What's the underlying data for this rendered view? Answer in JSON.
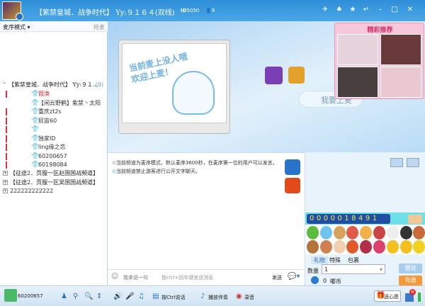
{
  "header": {
    "title": "【紫禁皇城．战争时代】 Yy:９１６４(双线)",
    "id_label": "ID",
    "id_value": "5050",
    "user_count": "9",
    "window_buttons": [
      "plane-icon",
      "skin-icon",
      "star-icon",
      "back-icon",
      "minimize-icon",
      "maximize-icon",
      "close-icon"
    ]
  },
  "left": {
    "mode": "麦序模式",
    "grab": "抢麦",
    "root": "【紫禁皇城．战争时代】 Yy:９１...",
    "root_count": "(9)",
    "users": [
      {
        "name": "葭涣",
        "color": "#e02020",
        "mic": true
      },
      {
        "name": "【闲云野鹤】紫禁丶太阳",
        "color": "#333",
        "mic": false,
        "shirt": "#7a3fb4"
      },
      {
        "name": "重庆zt2s",
        "color": "#333",
        "mic": true
      },
      {
        "name": "屁宙60",
        "color": "#333",
        "mic": true
      },
      {
        "name": "",
        "color": "#333",
        "mic": true
      },
      {
        "name": "独家ID",
        "color": "#333",
        "mic": true
      },
      {
        "name": "ling缘之恋",
        "color": "#333",
        "mic": true
      },
      {
        "name": "60200657",
        "color": "#333",
        "mic": true
      },
      {
        "name": "60198084",
        "color": "#333",
        "mic": true
      }
    ],
    "channels": [
      "【征途2．页服一区赵国国战频道】",
      "【征途2．页服一区吴国国战频道】",
      "222222222222"
    ]
  },
  "stage": {
    "screen_text_1": "当前麦上没人哦",
    "screen_text_2": "欢迎上麦！",
    "mic_button": "我要上麦",
    "recommend_title": "精彩推荐"
  },
  "chat": {
    "messages": [
      "当前频道为麦序模式，默认麦序3600秒，在麦序第一位的用户可以发言。",
      "当前频道禁止游客进行公开文字聊天。"
    ],
    "input_placeholder": "我来说一句",
    "input_hint": "按ctrl+回车键发送消息",
    "send": "发送"
  },
  "gift": {
    "counter": "0000018491",
    "tabs": [
      "礼物",
      "特殊",
      "包裹"
    ],
    "quantity_label": "数量",
    "quantity": "1",
    "give": "赠送",
    "coins": "0",
    "coin_unit": "嘟币",
    "recharge": "充值"
  },
  "bottom": {
    "user": "60200657",
    "ptt": "按Ctrl说话",
    "accompany": "播放伴奏",
    "record": "录音",
    "gift_btn": "送心愿",
    "badge": "N"
  }
}
